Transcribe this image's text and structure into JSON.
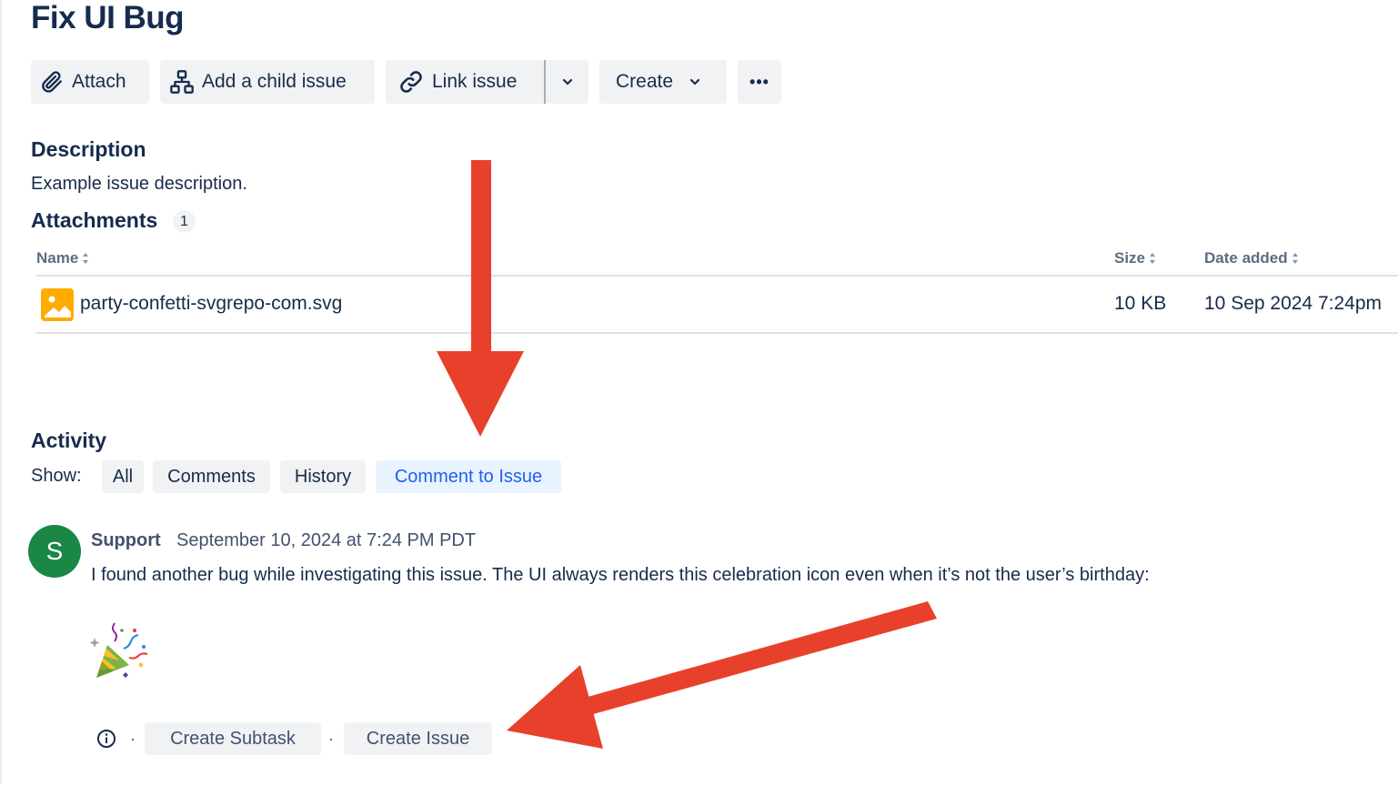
{
  "issue": {
    "title": "Fix UI Bug"
  },
  "toolbar": {
    "attach_label": "Attach",
    "child_label": "Add a child issue",
    "link_label": "Link issue",
    "create_label": "Create",
    "more_label": "•••"
  },
  "description": {
    "heading": "Description",
    "text": "Example issue description."
  },
  "attachments": {
    "heading": "Attachments",
    "count": "1",
    "columns": {
      "name": "Name",
      "size": "Size",
      "date": "Date added"
    },
    "rows": [
      {
        "name": "party-confetti-svgrepo-com.svg",
        "size": "10 KB",
        "date": "10 Sep 2024 7:24pm"
      }
    ]
  },
  "activity": {
    "heading": "Activity",
    "show_label": "Show:",
    "tabs": [
      "All",
      "Comments",
      "History",
      "Comment to Issue"
    ],
    "active_tab": "Comment to Issue"
  },
  "comment": {
    "avatar_initial": "S",
    "author": "Support",
    "date": "September 10, 2024 at 7:24 PM PDT",
    "text": "I found another bug while investigating this issue. The UI always renders this celebration icon even when it’s not the user’s birthday:",
    "separator": "·",
    "actions": [
      "Create Subtask",
      "Create Issue"
    ]
  },
  "colors": {
    "text": "#172b4d",
    "subtle": "#42526e",
    "button_bg": "#f1f2f4",
    "active_tab_bg": "#e9f2ff",
    "active_tab_text": "#1d63ed",
    "avatar": "#1a8745",
    "file_icon": "#ffab00",
    "annotation_arrow": "#e8412b"
  },
  "icons": [
    "paperclip-icon",
    "hierarchy-icon",
    "link-icon",
    "chevron-down-icon",
    "more-icon",
    "image-file-icon",
    "confetti-icon",
    "info-icon",
    "sort-icon"
  ]
}
